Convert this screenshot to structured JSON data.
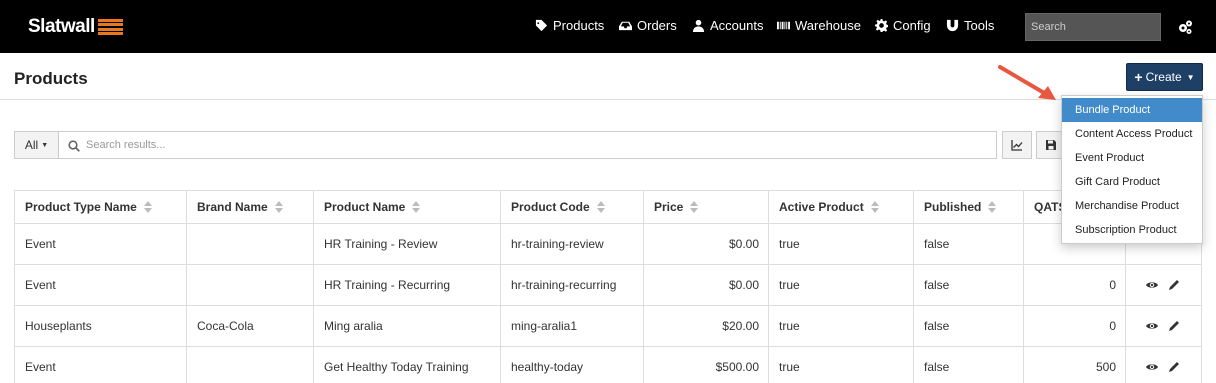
{
  "brand": {
    "logo_text": "Slatwall",
    "accent": "#e87722"
  },
  "nav": {
    "items": [
      {
        "label": "Products",
        "icon": "tags-icon"
      },
      {
        "label": "Orders",
        "icon": "inbox-icon"
      },
      {
        "label": "Accounts",
        "icon": "user-icon"
      },
      {
        "label": "Warehouse",
        "icon": "barcode-icon"
      },
      {
        "label": "Config",
        "icon": "gear-icon"
      },
      {
        "label": "Tools",
        "icon": "magnet-icon"
      }
    ],
    "search_placeholder": "Search",
    "settings_icon": "gears-icon"
  },
  "header": {
    "title": "Products",
    "create_label": "Create"
  },
  "create_menu": {
    "items": [
      "Bundle Product",
      "Content Access Product",
      "Event Product",
      "Gift Card Product",
      "Merchandise Product",
      "Subscription Product"
    ],
    "active_index": 0,
    "active_color": "#428bca"
  },
  "filter": {
    "scope_label": "All",
    "search_placeholder": "Search results..."
  },
  "table": {
    "columns": [
      "Product Type Name",
      "Brand Name",
      "Product Name",
      "Product Code",
      "Price",
      "Active Product",
      "Published",
      "QATS"
    ],
    "rows": [
      {
        "type": "Event",
        "brand": "",
        "name": "HR Training - Review",
        "code": "hr-training-review",
        "price": "$0.00",
        "active": "true",
        "published": "false",
        "qats": ""
      },
      {
        "type": "Event",
        "brand": "",
        "name": "HR Training - Recurring",
        "code": "hr-training-recurring",
        "price": "$0.00",
        "active": "true",
        "published": "false",
        "qats": "0"
      },
      {
        "type": "Houseplants",
        "brand": "Coca-Cola",
        "name": "Ming aralia",
        "code": "ming-aralia1",
        "price": "$20.00",
        "active": "true",
        "published": "false",
        "qats": "0"
      },
      {
        "type": "Event",
        "brand": "",
        "name": "Get Healthy Today Training",
        "code": "healthy-today",
        "price": "$500.00",
        "active": "true",
        "published": "false",
        "qats": "500"
      }
    ]
  },
  "colors": {
    "topbar": "#000000",
    "create_button": "#1e3f66",
    "annotation_arrow": "#e8573f"
  }
}
